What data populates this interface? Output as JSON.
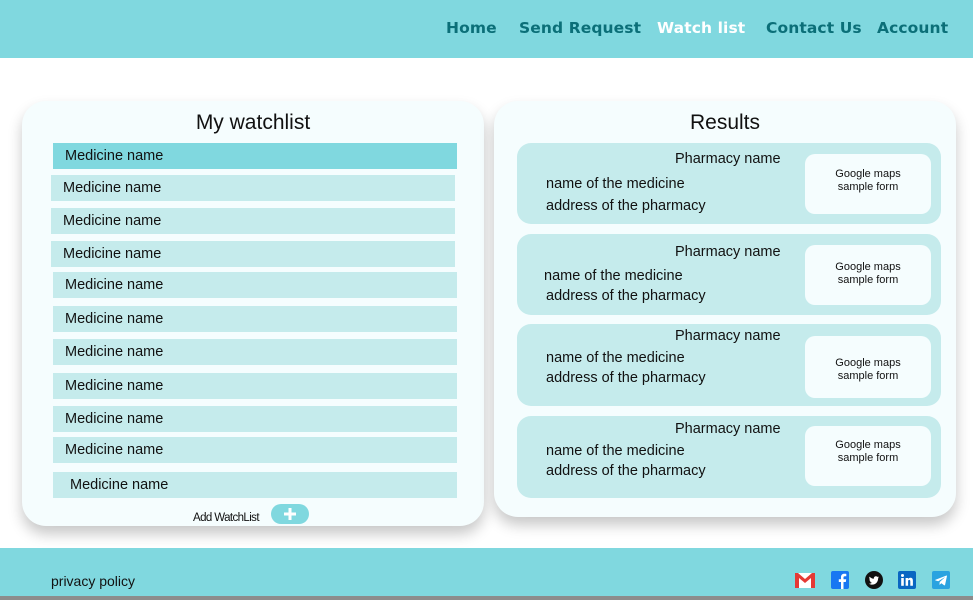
{
  "nav": {
    "home": "Home",
    "send_request": "Send Request",
    "watch_list": "Watch list",
    "contact_us": "Contact Us",
    "account": "Account"
  },
  "watchlist": {
    "title": "My watchlist",
    "items": [
      "Medicine name",
      "Medicine name",
      "Medicine name",
      "Medicine name",
      "Medicine name",
      "Medicine name",
      "Medicine name",
      "Medicine name",
      "Medicine name",
      "Medicine name",
      "Medicine name"
    ],
    "add_label": "Add WatchList"
  },
  "results": {
    "title": "Results",
    "cards": [
      {
        "pharmacy": "Pharmacy name",
        "medicine": "name of the medicine",
        "address": "address of the pharmacy",
        "map_line1": "Google maps",
        "map_line2": "sample form"
      },
      {
        "pharmacy": "Pharmacy name",
        "medicine": "name of the medicine",
        "address": "address of the pharmacy",
        "map_line1": "Google maps",
        "map_line2": "sample form"
      },
      {
        "pharmacy": "Pharmacy name",
        "medicine": "name of the medicine",
        "address": "address of the pharmacy",
        "map_line1": "Google maps",
        "map_line2": "sample form"
      },
      {
        "pharmacy": "Pharmacy name",
        "medicine": "name of the medicine",
        "address": "address of the pharmacy",
        "map_line1": "Google maps",
        "map_line2": "sample form"
      }
    ]
  },
  "footer": {
    "privacy": "privacy policy",
    "social_icons": [
      "gmail-icon",
      "facebook-icon",
      "twitter-icon",
      "linkedin-icon",
      "telegram-icon"
    ]
  },
  "colors": {
    "header_bg": "#80d8df",
    "nav_text": "#0b6f78",
    "nav_active": "#ffffff",
    "item_bg": "#c5ebec",
    "panel_bg": "#f5fdfe"
  }
}
